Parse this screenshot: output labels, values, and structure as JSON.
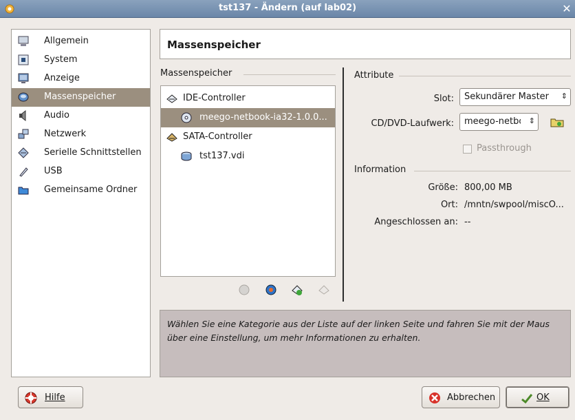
{
  "window": {
    "title": "tst137 - Ändern (auf lab02)",
    "close_glyph": "✕"
  },
  "sidebar": {
    "items": [
      {
        "label": "Allgemein",
        "icon": "monitor-icon"
      },
      {
        "label": "System",
        "icon": "chip-icon"
      },
      {
        "label": "Anzeige",
        "icon": "display-icon"
      },
      {
        "label": "Massenspeicher",
        "icon": "disk-icon",
        "active": true
      },
      {
        "label": "Audio",
        "icon": "speaker-icon"
      },
      {
        "label": "Netzwerk",
        "icon": "network-icon"
      },
      {
        "label": "Serielle Schnittstellen",
        "icon": "serial-icon"
      },
      {
        "label": "USB",
        "icon": "usb-icon"
      },
      {
        "label": "Gemeinsame Ordner",
        "icon": "folder-icon"
      }
    ]
  },
  "header": {
    "title": "Massenspeicher"
  },
  "storage": {
    "group_label": "Massenspeicher",
    "tree": [
      {
        "label": "IDE-Controller",
        "type": "controller"
      },
      {
        "label": "meego-netbook-ia32-1.0.0...",
        "type": "optical",
        "selected": true
      },
      {
        "label": "SATA-Controller",
        "type": "controller"
      },
      {
        "label": "tst137.vdi",
        "type": "harddisk"
      }
    ]
  },
  "attributes": {
    "group_label": "Attribute",
    "slot_label": "Slot:",
    "slot_value": "Sekundärer Master",
    "drive_label": "CD/DVD-Laufwerk:",
    "drive_value": "meego-netbo",
    "passthrough_label": "Passthrough"
  },
  "information": {
    "group_label": "Information",
    "size_label": "Größe:",
    "size_value": "800,00 MB",
    "location_label": "Ort:",
    "location_value": "/mntn/swpool/miscO...",
    "attached_label": "Angeschlossen an:",
    "attached_value": "--"
  },
  "help": {
    "text": "Wählen Sie eine Kategorie aus der Liste auf der linken Seite und fahren Sie mit der Maus über eine Einstellung, um mehr Informationen zu erhalten."
  },
  "buttons": {
    "help": "Hilfe",
    "cancel": "Abbrechen",
    "ok": "OK"
  }
}
